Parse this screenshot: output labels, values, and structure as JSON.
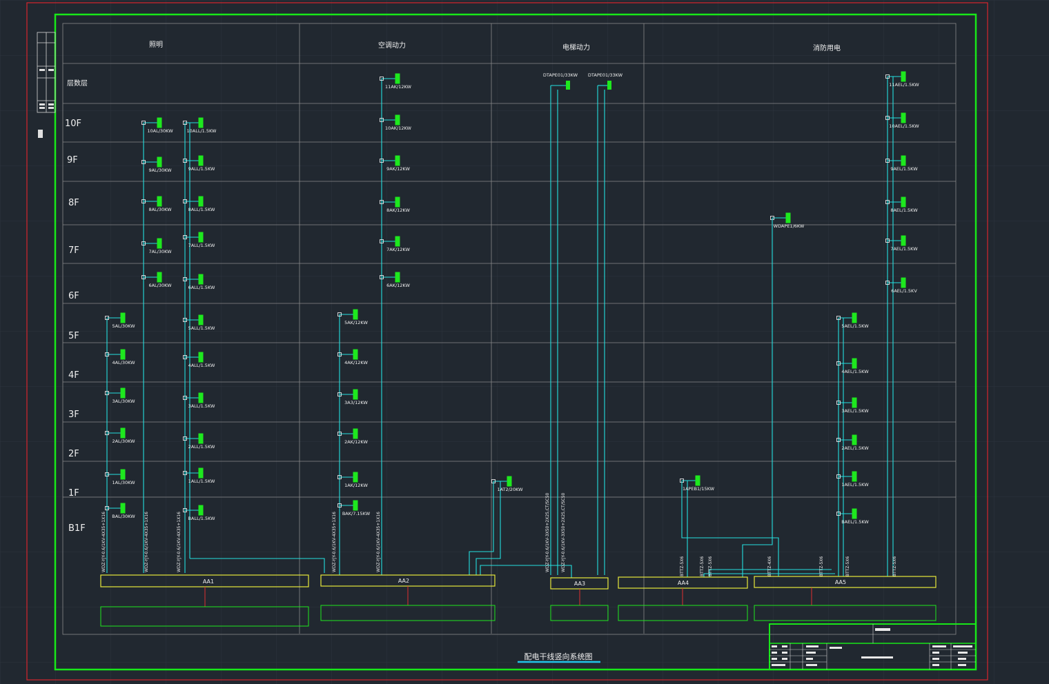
{
  "drawing_title": "配电干线竖向系统图",
  "colors": {
    "background": "#212830",
    "grid": "#2e353f",
    "outer_frame": "#e0303a",
    "border": "#17e817",
    "table_line": "#8a8a8a",
    "cable": "#25e0e0",
    "box": "#1ee81e",
    "bus": "#e8e83a",
    "text": "#f0f0f0",
    "drop": "#e33030"
  },
  "sections": [
    {
      "name": "照明",
      "bus": "AA1"
    },
    {
      "name": "空调动力",
      "bus": "AA2"
    },
    {
      "name": "电梯动力",
      "bus": "AA3"
    },
    {
      "name": "消防用电",
      "bus": ""
    }
  ],
  "layer_header": "层数层",
  "floors": [
    "10F",
    "9F",
    "8F",
    "7F",
    "6F",
    "5F",
    "4F",
    "3F",
    "2F",
    "1F",
    "B1F"
  ],
  "bus_bars": [
    "AA1",
    "AA2",
    "AA3",
    "AA4",
    "AA5"
  ],
  "lighting_panels_high": [
    "10AL/30KW",
    "9AL/30KW",
    "8AL/30KW",
    "7AL/30KW",
    "6AL/30KW"
  ],
  "lighting_panels_low": [
    "5AL/30KW",
    "4AL/30KW",
    "3AL/30KW",
    "2AL/30KW",
    "1AL/30KW",
    "BAL/30KW"
  ],
  "emergency_lighting": [
    "10ALL/1.5KW",
    "9ALL/1.5KW",
    "8ALL/1.5KW",
    "7ALL/1.5KW",
    "6ALL/1.5KW",
    "5ALL/1.5KW",
    "4ALL/1.5KW",
    "3ALL/1.5KW",
    "2ALL/1.5KW",
    "1ALL/1.5KW",
    "BALL/1.5KW"
  ],
  "ac_panels_high": [
    "11AK/12KW",
    "10AK/12KW",
    "9AK/12KW",
    "8AK/12KW",
    "7AK/12KW",
    "6AK/12KW"
  ],
  "ac_panels_low": [
    "5AK/12KW",
    "4AK/12KW",
    "3A3/12KW",
    "2AK/12KW",
    "1AK/12KW",
    "BAK/7.15KW"
  ],
  "elevator_panels": [
    "DTAPE01/33KW",
    "DTAPE01/33KW"
  ],
  "other_panels": {
    "at1": "1AT2/20KW",
    "apeb1": "1APEB1/15KW",
    "wdap": "WDAPE1/6KW"
  },
  "fire_high": [
    "11AEL/1.5KW",
    "10AEL/1.5KW",
    "9AEL/1.5KW",
    "8AEL/1.5KW",
    "7AEL/1.5KW",
    "6AEL/1.5KV"
  ],
  "fire_low": [
    "5AEL/1.5KW",
    "4AEL/1.5KW",
    "3AEL/1.5KW",
    "2AEL/1.5KW",
    "1AEL/1.5KW",
    "BAEL/1.5KW"
  ],
  "cable_labels": {
    "c1": "WDZ-YJY-0.6/1KV-4X35+1X16",
    "c2": "WDZ-YJY-0.6/1KV-4X35+1X16",
    "c3": "WDZ-YJY-0.6/1KV-4X35+1X16",
    "c4": "WDZ-YJY-0.6/1KV-4X35+1X16",
    "c5": "WDZ-YJY-0.6/1KV-4X35+1X16",
    "c6": "WDZ-YJY-0.6/1KV-3X50+2X25,CT/SC50",
    "c7": "WDZ-YJY-0.6/1KV-3X50+2X25,CT/SC50",
    "f1": "BTTZ-5X6",
    "f2": "BTTZ-5X6",
    "f3": "BTTZ-5X6",
    "f4": "BTTZ-4X6",
    "f5": "BTTZ-5X6",
    "f6": "BTTZ-5X6",
    "f7": "BTTZ-5X6"
  }
}
